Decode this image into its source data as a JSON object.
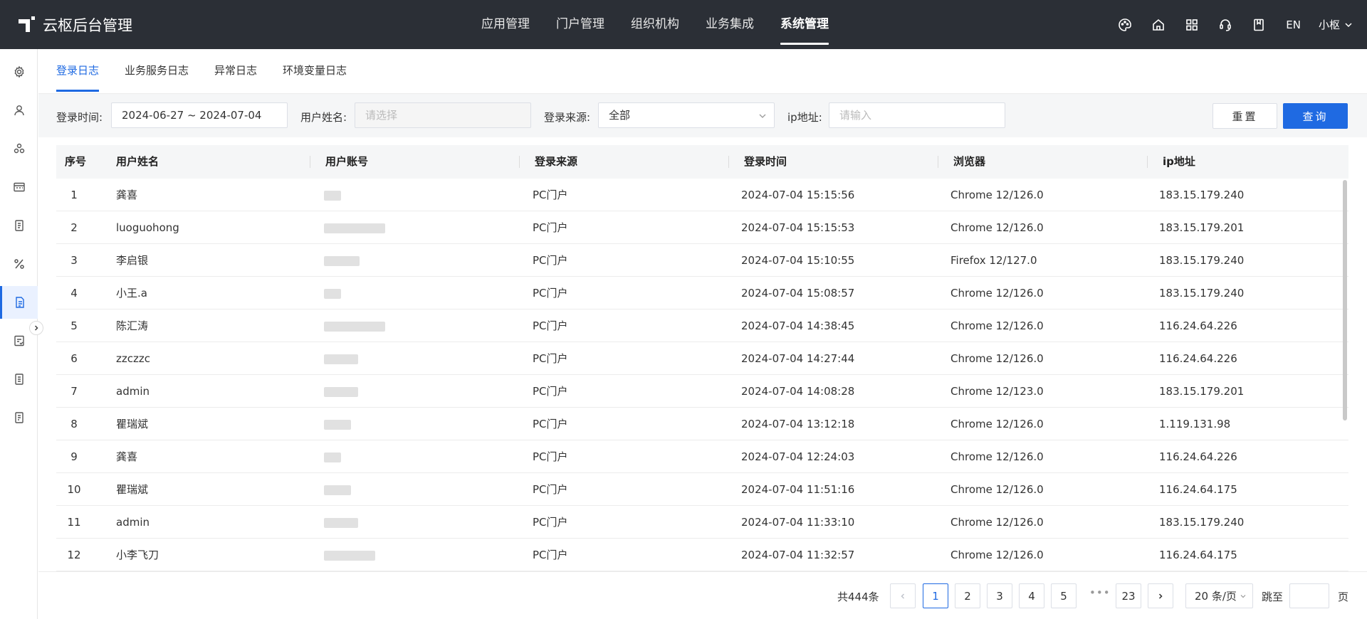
{
  "app": {
    "title": "云枢后台管理"
  },
  "nav": {
    "items": [
      {
        "label": "应用管理",
        "active": false
      },
      {
        "label": "门户管理",
        "active": false
      },
      {
        "label": "组织机构",
        "active": false
      },
      {
        "label": "业务集成",
        "active": false
      },
      {
        "label": "系统管理",
        "active": true
      }
    ]
  },
  "top_tools": {
    "icons": [
      "palette-icon",
      "home-icon",
      "grid-icon",
      "headset-icon",
      "book-icon"
    ],
    "lang": "EN",
    "user": "小枢"
  },
  "sidebar": {
    "icons": [
      "settings-icon",
      "user-icon",
      "apps-icon",
      "panel-icon",
      "document-icon",
      "percent-icon",
      "log-file-icon",
      "form-check-icon",
      "report-icon",
      "archive-icon"
    ],
    "active_index": 6
  },
  "tabs": [
    {
      "label": "登录日志",
      "active": true
    },
    {
      "label": "业务服务日志",
      "active": false
    },
    {
      "label": "异常日志",
      "active": false
    },
    {
      "label": "环境变量日志",
      "active": false
    }
  ],
  "filters": {
    "login_time_label": "登录时间:",
    "login_time_value": "2024-06-27 ~ 2024-07-04",
    "username_label": "用户姓名:",
    "username_placeholder": "请选择",
    "source_label": "登录来源:",
    "source_value": "全部",
    "ip_label": "ip地址:",
    "ip_placeholder": "请输入",
    "reset": "重置",
    "query": "查询"
  },
  "table": {
    "headers": [
      "序号",
      "用户姓名",
      "用户账号",
      "登录来源",
      "登录时间",
      "浏览器",
      "ip地址"
    ],
    "rows": [
      {
        "idx": "1",
        "name": "龚喜",
        "source": "PC门户",
        "time": "2024-07-04 15:15:56",
        "browser": "Chrome 12/126.0",
        "ip": "183.15.179.240"
      },
      {
        "idx": "2",
        "name": "luoguohong",
        "source": "PC门户",
        "time": "2024-07-04 15:15:53",
        "browser": "Chrome 12/126.0",
        "ip": "183.15.179.201"
      },
      {
        "idx": "3",
        "name": "李启银",
        "source": "PC门户",
        "time": "2024-07-04 15:10:55",
        "browser": "Firefox 12/127.0",
        "ip": "183.15.179.240"
      },
      {
        "idx": "4",
        "name": "小王.a",
        "source": "PC门户",
        "time": "2024-07-04 15:08:57",
        "browser": "Chrome 12/126.0",
        "ip": "183.15.179.240"
      },
      {
        "idx": "5",
        "name": "陈汇涛",
        "source": "PC门户",
        "time": "2024-07-04 14:38:45",
        "browser": "Chrome 12/126.0",
        "ip": "116.24.64.226"
      },
      {
        "idx": "6",
        "name": "zzczzc",
        "source": "PC门户",
        "time": "2024-07-04 14:27:44",
        "browser": "Chrome 12/126.0",
        "ip": "116.24.64.226"
      },
      {
        "idx": "7",
        "name": "admin",
        "source": "PC门户",
        "time": "2024-07-04 14:08:28",
        "browser": "Chrome 12/123.0",
        "ip": "183.15.179.201"
      },
      {
        "idx": "8",
        "name": "瞿瑞斌",
        "source": "PC门户",
        "time": "2024-07-04 13:12:18",
        "browser": "Chrome 12/126.0",
        "ip": "1.119.131.98"
      },
      {
        "idx": "9",
        "name": "龚喜",
        "source": "PC门户",
        "time": "2024-07-04 12:24:03",
        "browser": "Chrome 12/126.0",
        "ip": "116.24.64.226"
      },
      {
        "idx": "10",
        "name": "瞿瑞斌",
        "source": "PC门户",
        "time": "2024-07-04 11:51:16",
        "browser": "Chrome 12/126.0",
        "ip": "116.24.64.175"
      },
      {
        "idx": "11",
        "name": "admin",
        "source": "PC门户",
        "time": "2024-07-04 11:33:10",
        "browser": "Chrome 12/126.0",
        "ip": "183.15.179.240"
      },
      {
        "idx": "12",
        "name": "小李飞刀",
        "source": "PC门户",
        "time": "2024-07-04 11:32:57",
        "browser": "Chrome 12/126.0",
        "ip": "116.24.64.175"
      }
    ]
  },
  "pagination": {
    "total": "共444条",
    "pages": [
      "1",
      "2",
      "3",
      "4",
      "5"
    ],
    "current": "1",
    "dots": "•••",
    "last": "23",
    "page_size": "20 条/页",
    "jump_label": "跳至",
    "page_label": "页"
  }
}
